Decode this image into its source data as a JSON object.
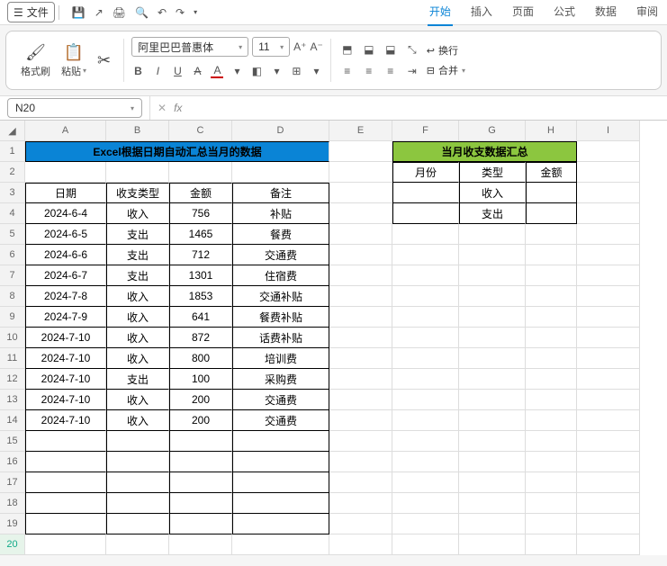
{
  "menubar": {
    "file": "文件",
    "tabs": [
      "开始",
      "插入",
      "页面",
      "公式",
      "数据",
      "审阅"
    ],
    "active_tab": "开始"
  },
  "ribbon": {
    "format_painter": "格式刷",
    "paste": "粘贴",
    "font_name": "阿里巴巴普惠体",
    "font_size": "11",
    "bold": "B",
    "italic": "I",
    "underline": "U",
    "wrap": "换行",
    "merge": "合并"
  },
  "formula_bar": {
    "namebox": "N20",
    "fx": "fx"
  },
  "columns": [
    "A",
    "B",
    "C",
    "D",
    "E",
    "F",
    "G",
    "H",
    "I"
  ],
  "row_count": 20,
  "selected_row": 20,
  "main_title": "Excel根据日期自动汇总当月的数据",
  "summary_title": "当月收支数据汇总",
  "main_headers": {
    "date": "日期",
    "type": "收支类型",
    "amount": "金额",
    "note": "备注"
  },
  "summary_headers": {
    "month": "月份",
    "type": "类型",
    "amount": "金额"
  },
  "summary_rows": [
    {
      "month": "",
      "type": "收入",
      "amount": ""
    },
    {
      "month": "",
      "type": "支出",
      "amount": ""
    }
  ],
  "data": [
    {
      "date": "2024-6-4",
      "type": "收入",
      "amount": "756",
      "note": "补贴"
    },
    {
      "date": "2024-6-5",
      "type": "支出",
      "amount": "1465",
      "note": "餐费"
    },
    {
      "date": "2024-6-6",
      "type": "支出",
      "amount": "712",
      "note": "交通费"
    },
    {
      "date": "2024-6-7",
      "type": "支出",
      "amount": "1301",
      "note": "住宿费"
    },
    {
      "date": "2024-7-8",
      "type": "收入",
      "amount": "1853",
      "note": "交通补贴"
    },
    {
      "date": "2024-7-9",
      "type": "收入",
      "amount": "641",
      "note": "餐费补贴"
    },
    {
      "date": "2024-7-10",
      "type": "收入",
      "amount": "872",
      "note": "话费补贴"
    },
    {
      "date": "2024-7-10",
      "type": "收入",
      "amount": "800",
      "note": "培训费"
    },
    {
      "date": "2024-7-10",
      "type": "支出",
      "amount": "100",
      "note": "采购费"
    },
    {
      "date": "2024-7-10",
      "type": "收入",
      "amount": "200",
      "note": "交通费"
    },
    {
      "date": "2024-7-10",
      "type": "收入",
      "amount": "200",
      "note": "交通费"
    }
  ],
  "chart_data": {
    "type": "table",
    "title": "Excel根据日期自动汇总当月的数据",
    "columns": [
      "日期",
      "收支类型",
      "金额",
      "备注"
    ],
    "rows": [
      [
        "2024-6-4",
        "收入",
        756,
        "补贴"
      ],
      [
        "2024-6-5",
        "支出",
        1465,
        "餐费"
      ],
      [
        "2024-6-6",
        "支出",
        712,
        "交通费"
      ],
      [
        "2024-6-7",
        "支出",
        1301,
        "住宿费"
      ],
      [
        "2024-7-8",
        "收入",
        1853,
        "交通补贴"
      ],
      [
        "2024-7-9",
        "收入",
        641,
        "餐费补贴"
      ],
      [
        "2024-7-10",
        "收入",
        872,
        "话费补贴"
      ],
      [
        "2024-7-10",
        "收入",
        800,
        "培训费"
      ],
      [
        "2024-7-10",
        "支出",
        100,
        "采购费"
      ],
      [
        "2024-7-10",
        "收入",
        200,
        "交通费"
      ],
      [
        "2024-7-10",
        "收入",
        200,
        "交通费"
      ]
    ]
  }
}
